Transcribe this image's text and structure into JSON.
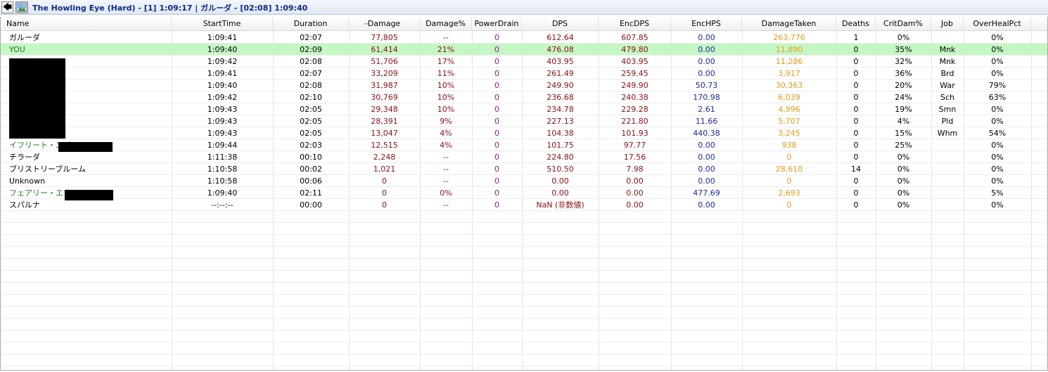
{
  "window": {
    "title": "The Howling Eye (Hard) - [1] 1:09:17 | ガルーダ - [02:08] 1:09:40",
    "back_glyph": "🡄",
    "back_icon": "back-arrow-icon",
    "image_icon": "image-icon"
  },
  "columns": [
    "Name",
    "StartTime",
    "Duration",
    "Damage",
    "Damage%",
    "PowerDrain",
    "DPS",
    "EncDPS",
    "EncHPS",
    "DamageTaken",
    "Deaths",
    "CritDam%",
    "Job",
    "OverHealPct"
  ],
  "sort": {
    "column": "Damage",
    "direction": "descending",
    "glyph": "⌄"
  },
  "colors": {
    "damage": "#8b1010",
    "powerdrain": "#a010a0",
    "hps": "#1a2a9c",
    "damagetaken": "#e79a1a",
    "pet_name": "#1f7a1f",
    "you_row_bg": "#c5f7c5"
  },
  "rows": [
    {
      "name": "ガルーダ",
      "starttime": "1:09:41",
      "duration": "02:07",
      "damage": "77,805",
      "damage_pct": "--",
      "powerdrain": "0",
      "dps": "612.64",
      "encdps": "607.85",
      "enchps": "0.00",
      "damagetaken": "263,776",
      "deaths": "1",
      "critdam": "0%",
      "job": "",
      "overheal": "0%"
    },
    {
      "name": "YOU",
      "starttime": "1:09:40",
      "duration": "02:09",
      "damage": "61,414",
      "damage_pct": "21%",
      "powerdrain": "0",
      "dps": "476.08",
      "encdps": "479.80",
      "enchps": "0.00",
      "damagetaken": "11,890",
      "deaths": "0",
      "critdam": "35%",
      "job": "Mnk",
      "overheal": "0%"
    },
    {
      "name": "",
      "starttime": "1:09:42",
      "duration": "02:08",
      "damage": "51,706",
      "damage_pct": "17%",
      "powerdrain": "0",
      "dps": "403.95",
      "encdps": "403.95",
      "enchps": "0.00",
      "damagetaken": "11,286",
      "deaths": "0",
      "critdam": "32%",
      "job": "Mnk",
      "overheal": "0%"
    },
    {
      "name": "",
      "starttime": "1:09:41",
      "duration": "02:07",
      "damage": "33,209",
      "damage_pct": "11%",
      "powerdrain": "0",
      "dps": "261.49",
      "encdps": "259.45",
      "enchps": "0.00",
      "damagetaken": "3,917",
      "deaths": "0",
      "critdam": "36%",
      "job": "Brd",
      "overheal": "0%"
    },
    {
      "name": "",
      "starttime": "1:09:40",
      "duration": "02:08",
      "damage": "31,987",
      "damage_pct": "10%",
      "powerdrain": "0",
      "dps": "249.90",
      "encdps": "249.90",
      "enchps": "50.73",
      "damagetaken": "30,363",
      "deaths": "0",
      "critdam": "20%",
      "job": "War",
      "overheal": "79%"
    },
    {
      "name": "",
      "starttime": "1:09:42",
      "duration": "02:10",
      "damage": "30,769",
      "damage_pct": "10%",
      "powerdrain": "0",
      "dps": "236.68",
      "encdps": "240.38",
      "enchps": "170.98",
      "damagetaken": "6,039",
      "deaths": "0",
      "critdam": "24%",
      "job": "Sch",
      "overheal": "63%"
    },
    {
      "name": "",
      "starttime": "1:09:43",
      "duration": "02:05",
      "damage": "29,348",
      "damage_pct": "10%",
      "powerdrain": "0",
      "dps": "234.78",
      "encdps": "229.28",
      "enchps": "2.61",
      "damagetaken": "4,996",
      "deaths": "0",
      "critdam": "19%",
      "job": "Smn",
      "overheal": "0%"
    },
    {
      "name": "",
      "starttime": "1:09:43",
      "duration": "02:05",
      "damage": "28,391",
      "damage_pct": "9%",
      "powerdrain": "0",
      "dps": "227.13",
      "encdps": "221.80",
      "enchps": "11.66",
      "damagetaken": "5,707",
      "deaths": "0",
      "critdam": "4%",
      "job": "Pld",
      "overheal": "0%"
    },
    {
      "name": "",
      "starttime": "1:09:43",
      "duration": "02:05",
      "damage": "13,047",
      "damage_pct": "4%",
      "powerdrain": "0",
      "dps": "104.38",
      "encdps": "101.93",
      "enchps": "440.38",
      "damagetaken": "3,245",
      "deaths": "0",
      "critdam": "15%",
      "job": "Whm",
      "overheal": "54%"
    },
    {
      "name": "イフリート・エギ",
      "starttime": "1:09:44",
      "duration": "02:03",
      "damage": "12,515",
      "damage_pct": "4%",
      "powerdrain": "0",
      "dps": "101.75",
      "encdps": "97.77",
      "enchps": "0.00",
      "damagetaken": "938",
      "deaths": "0",
      "critdam": "25%",
      "job": "",
      "overheal": "0%"
    },
    {
      "name": "チラーダ",
      "starttime": "1:11:38",
      "duration": "00:10",
      "damage": "2,248",
      "damage_pct": "--",
      "powerdrain": "0",
      "dps": "224.80",
      "encdps": "17.56",
      "enchps": "0.00",
      "damagetaken": "0",
      "deaths": "0",
      "critdam": "0%",
      "job": "",
      "overheal": "0%"
    },
    {
      "name": "ブリストリーブルーム",
      "starttime": "1:10:58",
      "duration": "00:02",
      "damage": "1,021",
      "damage_pct": "--",
      "powerdrain": "0",
      "dps": "510.50",
      "encdps": "7.98",
      "enchps": "0.00",
      "damagetaken": "28,610",
      "deaths": "14",
      "critdam": "0%",
      "job": "",
      "overheal": "0%"
    },
    {
      "name": "Unknown",
      "starttime": "1:10:58",
      "duration": "00:06",
      "damage": "0",
      "damage_pct": "--",
      "powerdrain": "0",
      "dps": "0.00",
      "encdps": "0.00",
      "enchps": "0.00",
      "damagetaken": "0",
      "deaths": "0",
      "critdam": "0%",
      "job": "",
      "overheal": "0%"
    },
    {
      "name": "フェアリー・エオス",
      "starttime": "1:09:40",
      "duration": "02:11",
      "damage": "0",
      "damage_pct": "0%",
      "powerdrain": "0",
      "dps": "0.00",
      "encdps": "0.00",
      "enchps": "477.69",
      "damagetaken": "2,693",
      "deaths": "0",
      "critdam": "0%",
      "job": "",
      "overheal": "5%"
    },
    {
      "name": "スパルナ",
      "starttime": "--:--:--",
      "duration": "00:00",
      "damage": "0",
      "damage_pct": "--",
      "powerdrain": "0",
      "dps": "NaN (非数値)",
      "encdps": "0.00",
      "enchps": "0.00",
      "damagetaken": "0",
      "deaths": "0",
      "critdam": "0%",
      "job": "",
      "overheal": "0%"
    }
  ]
}
